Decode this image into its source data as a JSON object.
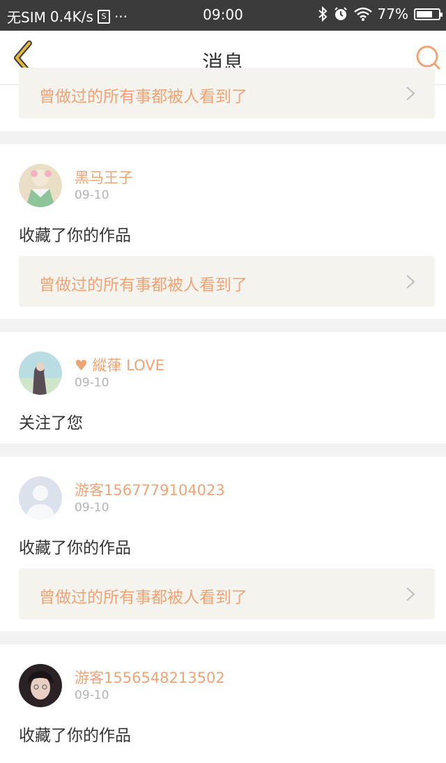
{
  "status_bar": {
    "carrier": "无SIM",
    "speed": "0.4K/s",
    "s_box": "S",
    "dots": "···",
    "time": "09:00",
    "battery": "77%",
    "battery_level": 0.77
  },
  "nav": {
    "title": "消息"
  },
  "top_work": {
    "title": "曾做过的所有事都被人看到了"
  },
  "messages": [
    {
      "username": "黑马王子",
      "date": "09-10",
      "action": "收藏了你的作品",
      "work_title": "曾做过的所有事都被人看到了"
    },
    {
      "username": "♥ 縱葎 LOVE",
      "date": "09-10",
      "action": "关注了您"
    },
    {
      "username": "游客1567779104023",
      "date": "09-10",
      "action": "收藏了你的作品",
      "work_title": "曾做过的所有事都被人看到了"
    },
    {
      "username": "游客1556548213502",
      "date": "09-10",
      "action": "收藏了你的作品"
    }
  ],
  "colors": {
    "accent": "#f0a374",
    "back_icon": "#e6b93a",
    "search_icon": "#f0a374",
    "work_bg": "#f4f3ee"
  }
}
